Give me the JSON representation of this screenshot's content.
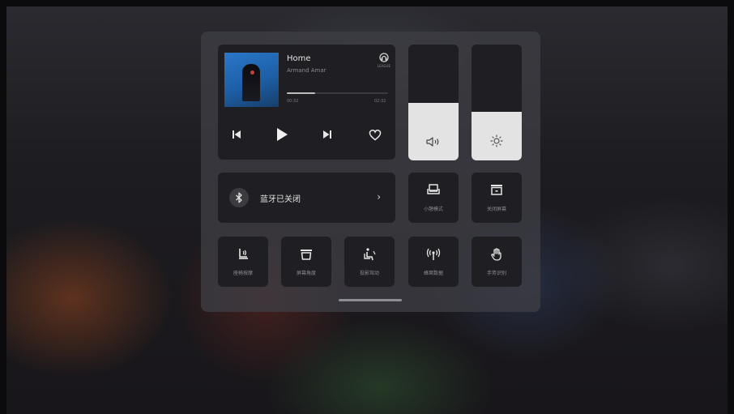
{
  "music": {
    "title": "Home",
    "artist": "Armand Amar",
    "source_icon": "music-source-icon",
    "source_label": "LEAGUE",
    "time_current": "00:32",
    "time_total": "02:32",
    "progress": 0.28
  },
  "sliders": {
    "volume_level": 0.5,
    "brightness_level": 0.42
  },
  "bluetooth": {
    "label": "蓝牙已关闭",
    "arrow": "›"
  },
  "tiles": {
    "nap_mode": "小憩模式",
    "close_screen": "关闭屏幕",
    "seat_massage": "座椅按摩",
    "screen_angle": "屏幕角度",
    "shadow_mode": "投影驾动",
    "hotspot": "蜂窝数据",
    "gesture": "手势识别"
  },
  "colors": {
    "panel": "#3e3e44",
    "card": "#1f1f23",
    "slider_fill": "#e3e3e3",
    "cover_blue": "#2a77c9"
  }
}
